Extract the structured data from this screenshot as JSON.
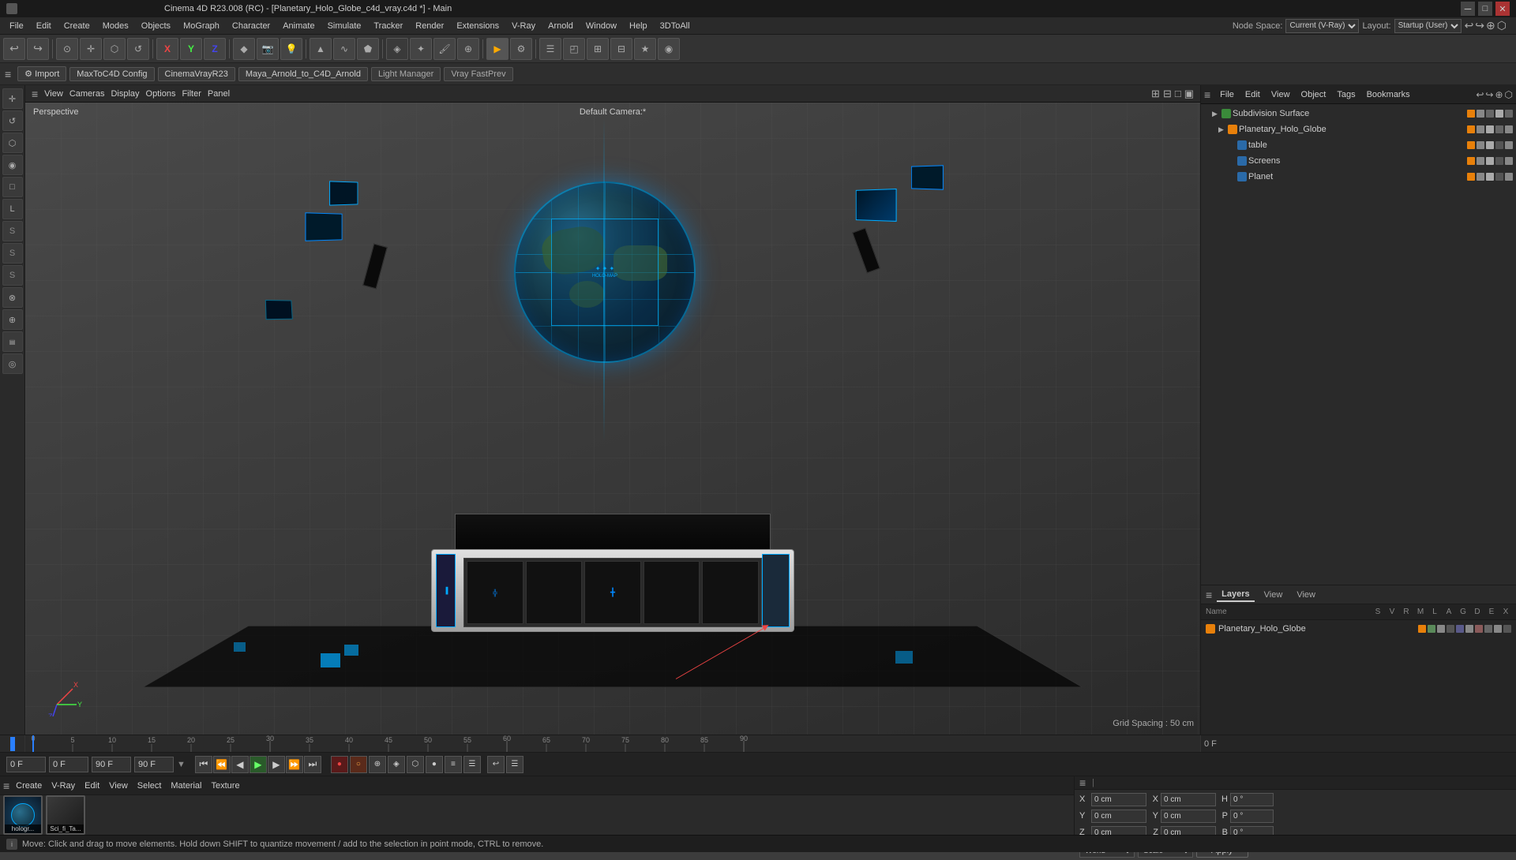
{
  "titlebar": {
    "title": "Cinema 4D R23.008 (RC) - [Planetary_Holo_Globe_c4d_vray.c4d *] - Main",
    "min": "─",
    "max": "□",
    "close": "✕"
  },
  "menubar": {
    "items": [
      "File",
      "Edit",
      "Create",
      "Modes",
      "Objects",
      "MoGraph",
      "Character",
      "Animate",
      "Simulate",
      "Tracker",
      "Render",
      "Extensions",
      "V-Ray",
      "Arnold",
      "Window",
      "Help",
      "3DToAll"
    ]
  },
  "toolbar": {
    "buttons": [
      "↩",
      "↪",
      "⊙",
      "◎",
      "⬡",
      "↺",
      "✦",
      "X",
      "Y",
      "Z",
      "◆",
      "⊕",
      "⊗",
      "⌂",
      "▣",
      "⊞",
      "⊟",
      "▲",
      "◉",
      "⊠",
      "⬟",
      "★",
      "∿",
      "☑",
      "⊙",
      "⊕",
      "⬡",
      "◈",
      "♦",
      "∿",
      "☰",
      "◰",
      "⬟"
    ]
  },
  "toolbar2": {
    "items": [
      {
        "label": "⚙ Import"
      },
      {
        "label": "MaxToC4D Config"
      },
      {
        "label": "CinemaVrayR23"
      },
      {
        "label": "Maya_Arnold_to_C4D_Arnold"
      },
      {
        "label": "Light Manager"
      },
      {
        "label": "Vray FastPrev"
      }
    ]
  },
  "viewport": {
    "mode": "Perspective",
    "camera": "Default Camera:*",
    "menu_items": [
      "View",
      "Cameras",
      "Display",
      "Options",
      "Filter",
      "Panel"
    ],
    "grid_spacing": "Grid Spacing : 50 cm"
  },
  "left_panel": {
    "tools": [
      "⟳",
      "⊕",
      "◈",
      "◉",
      "⬡",
      "▲",
      "◆",
      "⊞",
      "☰",
      "S",
      "S",
      "S",
      "⊗"
    ]
  },
  "right_panel": {
    "node_space_label": "Node Space:",
    "node_space_value": "Current (V-Ray)",
    "layout_label": "Layout:",
    "layout_value": "Startup (User)",
    "header_tabs": [
      "File",
      "Edit",
      "View",
      "Object",
      "Tags",
      "Bookmarks"
    ],
    "tree_items": [
      {
        "label": "Subdivision Surface",
        "icon": "orange",
        "indent": 0,
        "arrow": "▶"
      },
      {
        "label": "Planetary_Holo_Globe",
        "icon": "orange",
        "indent": 1,
        "arrow": "▶"
      },
      {
        "label": "table",
        "icon": "blue",
        "indent": 2,
        "arrow": ""
      },
      {
        "label": "Screens",
        "icon": "blue",
        "indent": 2,
        "arrow": ""
      },
      {
        "label": "Planet",
        "icon": "blue",
        "indent": 2,
        "arrow": ""
      }
    ]
  },
  "layers": {
    "tabs": [
      "Layers",
      "View"
    ],
    "active_tab": "Layers",
    "columns": {
      "name": "Name",
      "s": "S",
      "v": "V",
      "r": "R",
      "m": "M",
      "l": "L",
      "a": "A",
      "g": "G",
      "d": "D",
      "e": "E",
      "x": "X"
    },
    "items": [
      {
        "label": "Planetary_Holo_Globe",
        "color": "orange"
      }
    ]
  },
  "timeline": {
    "frames": [
      0,
      5,
      10,
      15,
      20,
      25,
      30,
      35,
      40,
      45,
      50,
      55,
      60,
      65,
      70,
      75,
      80,
      85,
      90
    ],
    "current_frame": "0 F",
    "end_frame": "90 F",
    "start_field": "0 F",
    "fps": "90 F"
  },
  "transport": {
    "frame_start": "0 F",
    "frame_cur": "0 F",
    "frame_end": "90 F",
    "fps_value": "90 F"
  },
  "material_bar": {
    "menus": [
      "Create",
      "V-Ray",
      "Edit",
      "View",
      "Select",
      "Material",
      "Texture"
    ],
    "materials": [
      {
        "label": "hologr...",
        "color": "#1a3a5a"
      },
      {
        "label": "Sci_fi_Ta...",
        "color": "#2a2a2a"
      }
    ]
  },
  "coordinates": {
    "header": "≡",
    "pos_x_label": "X",
    "pos_x_val": "0 cm",
    "pos_y_label": "Y",
    "pos_y_val": "0 cm",
    "pos_z_label": "Z",
    "pos_z_val": "0 cm",
    "size_x_label": "X",
    "size_x_val": "0 cm",
    "size_y_label": "Y",
    "size_y_val": "0 cm",
    "size_z_label": "Z",
    "size_z_val": "0 cm",
    "rot_h_label": "H",
    "rot_h_val": "0 °",
    "rot_p_label": "P",
    "rot_p_val": "0 °",
    "rot_b_label": "B",
    "rot_b_val": "0 °",
    "world_option": "World",
    "scale_option": "Scale",
    "apply_label": "Apply"
  },
  "statusbar": {
    "text": "Move: Click and drag to move elements. Hold down SHIFT to quantize movement / add to the selection in point mode, CTRL to remove."
  }
}
